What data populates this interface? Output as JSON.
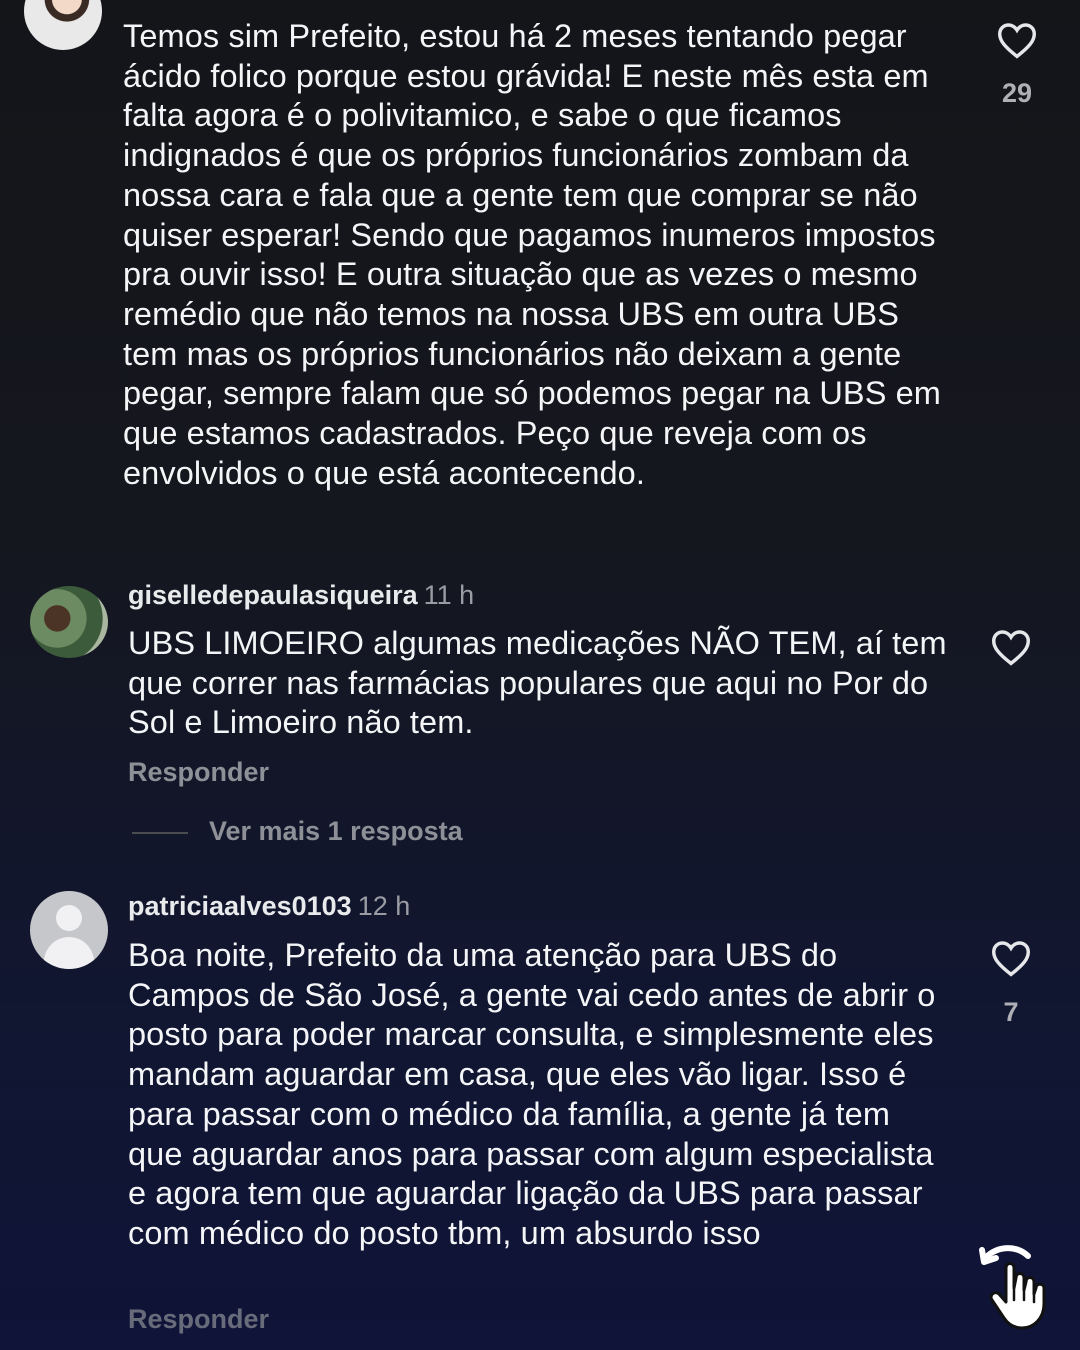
{
  "comments": [
    {
      "username": "",
      "time": "",
      "text": "Temos sim Prefeito, estou há 2 meses tentando pegar ácido folico porque estou grávida! E neste mês esta em falta agora é o polivitamico, e sabe o que ficamos indignados é que os próprios funcionários zombam da nossa cara e fala que a gente tem que comprar se não quiser esperar! Sendo que pagamos inumeros impostos pra ouvir isso! E outra situação que as vezes o mesmo remédio que não temos na nossa UBS em outra UBS tem mas os próprios funcionários não deixam a gente pegar, sempre falam que só podemos pegar na UBS em que estamos cadastrados. Peço que reveja com os envolvidos o que está acontecendo.",
      "likes": "29"
    },
    {
      "username": "giselledepaulasiqueira",
      "time": "11 h",
      "text": "UBS LIMOEIRO algumas medicações NÃO TEM, aí tem que correr nas farmácias populares que aqui no Por do Sol e Limoeiro não tem.",
      "likes": "",
      "reply_label": "Responder",
      "more_replies": "Ver mais 1 resposta"
    },
    {
      "username": "patriciaalves0103",
      "time": "12 h",
      "text": "Boa noite, Prefeito da uma atenção para UBS do Campos de São José, a gente vai cedo antes de abrir o posto para poder marcar consulta, e simplesmente eles mandam aguardar em casa, que eles vão ligar. Isso é para passar com o médico da família, a gente já  tem que aguardar anos para passar com algum especialista e agora tem que aguardar ligação da UBS para passar com médico do posto tbm, um absurdo isso",
      "likes": "7",
      "reply_label": "Responder"
    }
  ],
  "icons": {
    "like": "heart-outline-icon",
    "gesture": "tap-hand-icon"
  },
  "colors": {
    "text": "#f4f5f7",
    "muted": "#8e9097"
  }
}
